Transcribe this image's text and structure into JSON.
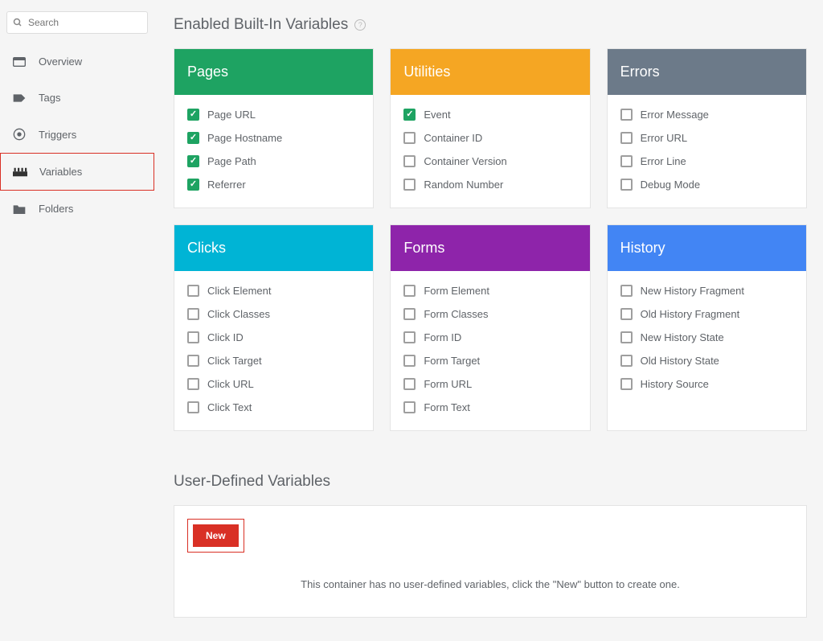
{
  "search": {
    "placeholder": "Search"
  },
  "sidebar": {
    "items": [
      {
        "label": "Overview",
        "icon": "overview",
        "active": false
      },
      {
        "label": "Tags",
        "icon": "tag",
        "active": false
      },
      {
        "label": "Triggers",
        "icon": "trigger",
        "active": false
      },
      {
        "label": "Variables",
        "icon": "variables",
        "active": true
      },
      {
        "label": "Folders",
        "icon": "folder",
        "active": false
      }
    ]
  },
  "builtin": {
    "title": "Enabled Built-In Variables",
    "groups": [
      {
        "title": "Pages",
        "color": "green",
        "items": [
          {
            "label": "Page URL",
            "checked": true
          },
          {
            "label": "Page Hostname",
            "checked": true
          },
          {
            "label": "Page Path",
            "checked": true
          },
          {
            "label": "Referrer",
            "checked": true
          }
        ]
      },
      {
        "title": "Utilities",
        "color": "orange",
        "items": [
          {
            "label": "Event",
            "checked": true
          },
          {
            "label": "Container ID",
            "checked": false
          },
          {
            "label": "Container Version",
            "checked": false
          },
          {
            "label": "Random Number",
            "checked": false
          }
        ]
      },
      {
        "title": "Errors",
        "color": "bluegrey",
        "items": [
          {
            "label": "Error Message",
            "checked": false
          },
          {
            "label": "Error URL",
            "checked": false
          },
          {
            "label": "Error Line",
            "checked": false
          },
          {
            "label": "Debug Mode",
            "checked": false
          }
        ]
      },
      {
        "title": "Clicks",
        "color": "cyan",
        "items": [
          {
            "label": "Click Element",
            "checked": false
          },
          {
            "label": "Click Classes",
            "checked": false
          },
          {
            "label": "Click ID",
            "checked": false
          },
          {
            "label": "Click Target",
            "checked": false
          },
          {
            "label": "Click URL",
            "checked": false
          },
          {
            "label": "Click Text",
            "checked": false
          }
        ]
      },
      {
        "title": "Forms",
        "color": "purple",
        "items": [
          {
            "label": "Form Element",
            "checked": false
          },
          {
            "label": "Form Classes",
            "checked": false
          },
          {
            "label": "Form ID",
            "checked": false
          },
          {
            "label": "Form Target",
            "checked": false
          },
          {
            "label": "Form URL",
            "checked": false
          },
          {
            "label": "Form Text",
            "checked": false
          }
        ]
      },
      {
        "title": "History",
        "color": "blue",
        "items": [
          {
            "label": "New History Fragment",
            "checked": false
          },
          {
            "label": "Old History Fragment",
            "checked": false
          },
          {
            "label": "New History State",
            "checked": false
          },
          {
            "label": "Old History State",
            "checked": false
          },
          {
            "label": "History Source",
            "checked": false
          }
        ]
      }
    ]
  },
  "userDefined": {
    "title": "User-Defined Variables",
    "newLabel": "New",
    "emptyMessage": "This container has no user-defined variables, click the \"New\" button to create one."
  }
}
